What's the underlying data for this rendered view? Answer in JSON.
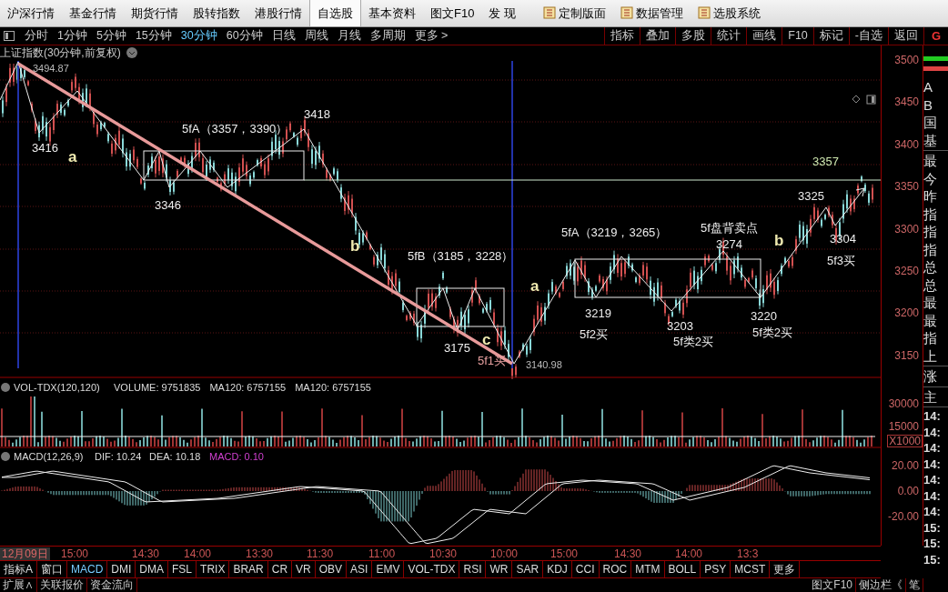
{
  "menu_bar": {
    "items": [
      {
        "label": "沪深行情",
        "kind": "tab",
        "selected": false
      },
      {
        "label": "基金行情",
        "kind": "tab",
        "selected": false
      },
      {
        "label": "期货行情",
        "kind": "tab",
        "selected": false
      },
      {
        "label": "股转指数",
        "kind": "tab",
        "selected": false
      },
      {
        "label": "港股行情",
        "kind": "tab",
        "selected": false
      },
      {
        "label": "自选股",
        "kind": "tab",
        "selected": true
      },
      {
        "label": "基本资料",
        "kind": "tab",
        "selected": false
      },
      {
        "label": "图文F10",
        "kind": "tab",
        "selected": false
      },
      {
        "label": "发  现",
        "kind": "tab",
        "selected": false
      },
      {
        "label": "定制版面",
        "kind": "tool",
        "selected": false
      },
      {
        "label": "数据管理",
        "kind": "tool",
        "selected": false
      },
      {
        "label": "选股系统",
        "kind": "tool",
        "selected": false
      }
    ]
  },
  "period_bar": {
    "periods": [
      {
        "label": "分时",
        "selected": false
      },
      {
        "label": "1分钟",
        "selected": false
      },
      {
        "label": "5分钟",
        "selected": false
      },
      {
        "label": "15分钟",
        "selected": false
      },
      {
        "label": "30分钟",
        "selected": true
      },
      {
        "label": "60分钟",
        "selected": false
      },
      {
        "label": "日线",
        "selected": false
      },
      {
        "label": "周线",
        "selected": false
      },
      {
        "label": "月线",
        "selected": false
      },
      {
        "label": "多周期",
        "selected": false
      },
      {
        "label": "更多 >",
        "selected": false
      }
    ],
    "tools": [
      "指标",
      "叠加",
      "多股",
      "统计",
      "画线",
      "F10",
      "标记",
      "-自选",
      "返回"
    ],
    "corner": "G"
  },
  "chart": {
    "title": "上证指数(30分钟,前复权)",
    "high_label": "3494.87",
    "low_label": "3140.98",
    "annotations": [
      {
        "text": "3416",
        "kind": "price"
      },
      {
        "text": "a",
        "kind": "wave"
      },
      {
        "text": "5fA（3357，3390）",
        "kind": "center"
      },
      {
        "text": "3418",
        "kind": "price"
      },
      {
        "text": "3346",
        "kind": "price"
      },
      {
        "text": "b",
        "kind": "wave"
      },
      {
        "text": "5fB（3185，3228）",
        "kind": "center"
      },
      {
        "text": "3175",
        "kind": "price"
      },
      {
        "text": "c",
        "kind": "wave"
      },
      {
        "text": "5f1买",
        "kind": "signal"
      },
      {
        "text": "a",
        "kind": "wave"
      },
      {
        "text": "5fA（3219，3265）",
        "kind": "center"
      },
      {
        "text": "3219",
        "kind": "price"
      },
      {
        "text": "5f2买",
        "kind": "price"
      },
      {
        "text": "3203",
        "kind": "price"
      },
      {
        "text": "5f类2买",
        "kind": "price"
      },
      {
        "text": "5f盘背卖点",
        "kind": "price"
      },
      {
        "text": "3274",
        "kind": "price"
      },
      {
        "text": "3220",
        "kind": "price"
      },
      {
        "text": "5f类2买",
        "kind": "price"
      },
      {
        "text": "b",
        "kind": "wave"
      },
      {
        "text": "3325",
        "kind": "price"
      },
      {
        "text": "3304",
        "kind": "price"
      },
      {
        "text": "5f3买",
        "kind": "price"
      },
      {
        "text": "3357",
        "kind": "level"
      }
    ],
    "y_axis": [
      "3500",
      "3450",
      "3400",
      "3350",
      "3300",
      "3250",
      "3200",
      "3150"
    ]
  },
  "volume": {
    "title": "VOL-TDX(120,120)",
    "values": [
      "VOLUME: 9751835",
      "MA120: 6757155",
      "MA120: 6757155"
    ],
    "y_axis": [
      "30000",
      "15000"
    ],
    "unit": "X1000"
  },
  "macd": {
    "title": "MACD(12,26,9)",
    "dif": "DIF: 10.24",
    "dea": "DEA: 10.18",
    "macd": "MACD: 0.10",
    "y_axis": [
      "20.00",
      "0.00",
      "-20.00"
    ]
  },
  "time_axis": [
    {
      "label": "12月09日",
      "selected": true
    },
    {
      "label": "15:00",
      "selected": false
    },
    {
      "label": "14:30",
      "selected": false
    },
    {
      "label": "14:00",
      "selected": false
    },
    {
      "label": "13:30",
      "selected": false
    },
    {
      "label": "11:30",
      "selected": false
    },
    {
      "label": "11:00",
      "selected": false
    },
    {
      "label": "10:30",
      "selected": false
    },
    {
      "label": "10:00",
      "selected": false
    },
    {
      "label": "15:00",
      "selected": false
    },
    {
      "label": "14:30",
      "selected": false
    },
    {
      "label": "14:00",
      "selected": false
    },
    {
      "label": "13:3",
      "selected": false
    }
  ],
  "indicator_tabs": [
    {
      "label": "指标A",
      "selected": false
    },
    {
      "label": "窗口",
      "selected": false
    },
    {
      "label": "MACD",
      "selected": true
    },
    {
      "label": "DMI",
      "selected": false
    },
    {
      "label": "DMA",
      "selected": false
    },
    {
      "label": "FSL",
      "selected": false
    },
    {
      "label": "TRIX",
      "selected": false
    },
    {
      "label": "BRAR",
      "selected": false
    },
    {
      "label": "CR",
      "selected": false
    },
    {
      "label": "VR",
      "selected": false
    },
    {
      "label": "OBV",
      "selected": false
    },
    {
      "label": "ASI",
      "selected": false
    },
    {
      "label": "EMV",
      "selected": false
    },
    {
      "label": "VOL-TDX",
      "selected": false
    },
    {
      "label": "RSI",
      "selected": false
    },
    {
      "label": "WR",
      "selected": false
    },
    {
      "label": "SAR",
      "selected": false
    },
    {
      "label": "KDJ",
      "selected": false
    },
    {
      "label": "CCI",
      "selected": false
    },
    {
      "label": "ROC",
      "selected": false
    },
    {
      "label": "MTM",
      "selected": false
    },
    {
      "label": "BOLL",
      "selected": false
    },
    {
      "label": "PSY",
      "selected": false
    },
    {
      "label": "MCST",
      "selected": false
    },
    {
      "label": "更多",
      "selected": false
    }
  ],
  "bottom_bar": {
    "left": [
      "扩展∧",
      "关联报价",
      "资金流向"
    ],
    "right": [
      "图文F10",
      "侧边栏《",
      "笔"
    ]
  },
  "side_panel": {
    "groups": [
      [
        "A",
        "B",
        "国",
        "基"
      ],
      [
        "最",
        "今",
        "昨",
        "指",
        "指",
        "指",
        "总",
        "总",
        "最",
        "最",
        "指",
        "上"
      ],
      [
        "涨"
      ],
      [
        "主"
      ]
    ],
    "times": [
      "14:",
      "14:",
      "14:",
      "14:",
      "14:",
      "14:",
      "14:",
      "15:",
      "15:",
      "15:"
    ]
  }
}
